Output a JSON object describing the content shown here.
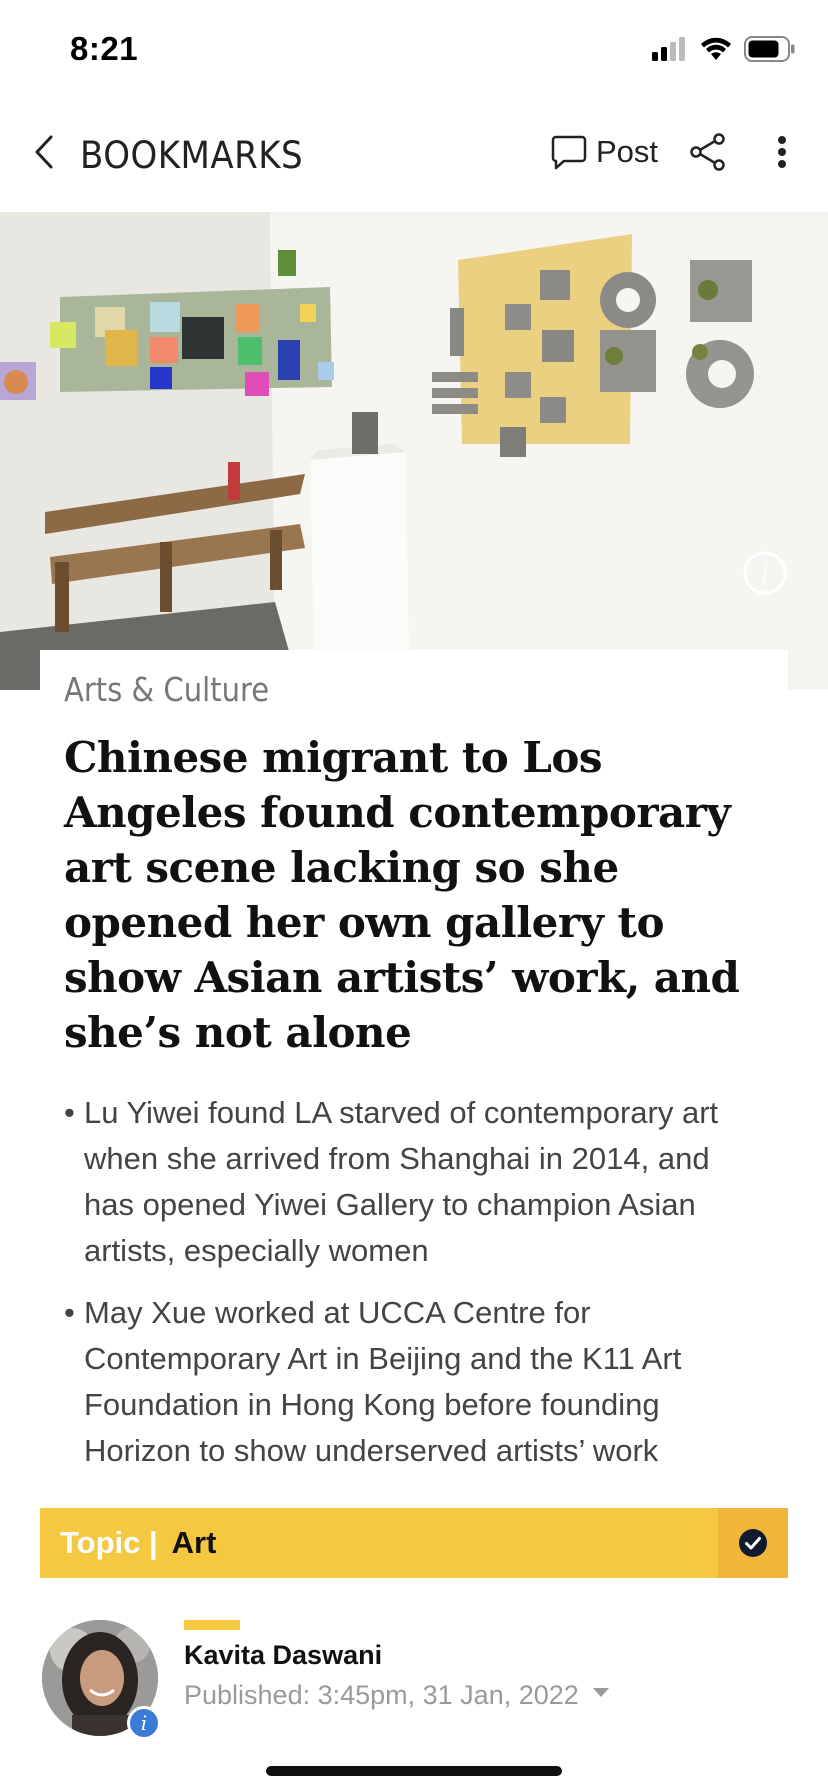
{
  "status_bar": {
    "time": "8:21",
    "icons": [
      "signal-icon",
      "wifi-icon",
      "battery-icon"
    ]
  },
  "header": {
    "back_icon": "chevron-left-icon",
    "title": "BOOKMARKS",
    "post_icon": "comment-icon",
    "post_label": "Post",
    "share_icon": "share-icon",
    "more_icon": "more-vertical-icon"
  },
  "hero": {
    "info_icon": "info-icon"
  },
  "article": {
    "section": "Arts & Culture",
    "headline": "Chinese migrant to Los Angeles found contemporary art scene lacking so she opened her own gallery to show Asian artists’ work, and she’s not alone",
    "bullets": [
      "Lu Yiwei found LA starved of contemporary art when she arrived from Shanghai in 2014, and has opened Yiwei Gallery to champion Asian artists, especially women",
      "May Xue worked at UCCA Centre for Contemporary Art in Beijing and the K11 Art Foundation in Hong Kong before founding Horizon to show underserved artists’ work"
    ]
  },
  "topic": {
    "prefix": "Topic |",
    "name": "Art",
    "follow_icon": "check-circle-icon"
  },
  "author": {
    "name": "Kavita Daswani",
    "published": "Published: 3:45pm, 31 Jan, 2022",
    "info_glyph": "i"
  },
  "colors": {
    "accent_yellow": "#f5c842",
    "follow_yellow": "#f0b63a",
    "info_blue": "#3a7bd5"
  }
}
